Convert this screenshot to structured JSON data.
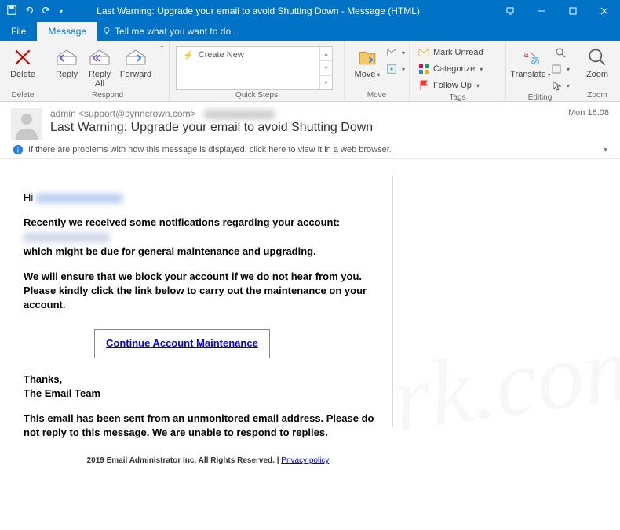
{
  "titlebar": {
    "title": "Last Warning: Upgrade your email to avoid Shutting Down - Message (HTML)"
  },
  "tabs": {
    "file": "File",
    "message": "Message",
    "tellme": "Tell me what you want to do..."
  },
  "ribbon": {
    "delete_grp": "Delete",
    "delete": "Delete",
    "respond_grp": "Respond",
    "reply": "Reply",
    "replyall": "Reply\nAll",
    "forward": "Forward",
    "quicksteps_grp": "Quick Steps",
    "createnew": "Create New",
    "move_grp": "Move",
    "move": "Move",
    "tags_grp": "Tags",
    "markunread": "Mark Unread",
    "categorize": "Categorize",
    "followup": "Follow Up",
    "editing_grp": "Editing",
    "translate": "Translate",
    "zoom_grp": "Zoom",
    "zoom": "Zoom"
  },
  "header": {
    "from": "admin <support@synncrown.com>",
    "subject": "Last Warning: Upgrade your email to avoid Shutting Down",
    "date": "Mon 16:08",
    "infobar": "If there are problems with how this message is displayed, click here to view it in a web browser."
  },
  "body": {
    "hi": "Hi",
    "p1a": "Recently we received some notifications regarding your account:",
    "p1b": "which might be due for general maintenance and upgrading.",
    "p2": "We will ensure that we block your account if we do not hear from you. Please kindly click the link below to carry out the maintenance on your account.",
    "linktext": "Continue Account Maintenance",
    "thanks": "Thanks,",
    "team": "The Email Team",
    "unmon": "This email has been sent from an unmonitored email address. Please do not reply to this message. We are unable to respond to replies.",
    "footer_txt": "2019 Email Administrator Inc. All Rights Reserved. | ",
    "privacy": "Privacy policy"
  }
}
